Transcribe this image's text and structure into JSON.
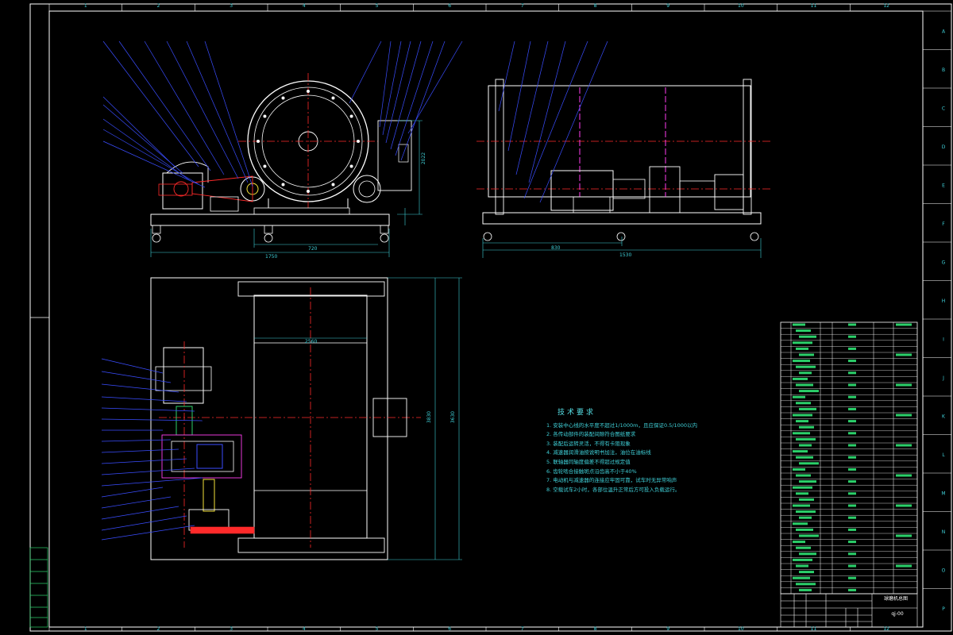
{
  "drawing": {
    "border_columns": [
      "1",
      "2",
      "3",
      "4",
      "5",
      "6",
      "7",
      "8",
      "9",
      "10",
      "11",
      "12"
    ],
    "border_rows": [
      "A",
      "B",
      "C",
      "D",
      "E",
      "F",
      "G",
      "H",
      "I",
      "J",
      "K",
      "L",
      "M",
      "N",
      "O",
      "P"
    ],
    "dimensions": {
      "side_height": "2022",
      "side_width": "1750",
      "side_inner": "720",
      "front_left": "830",
      "front_right": "1530",
      "plan_drum_width": "2560",
      "plan_height": "3830",
      "plan_height_outer": "3630"
    },
    "technical_requirements": {
      "title": "技术要求",
      "items": [
        "1. 安装中心线的水平度不超过1/1000m，且应保证0.5/1000以内",
        "2. 各传动部件的装配间隙符合图纸要求",
        "3. 装配后运转灵活，不得有卡阻现象",
        "4. 减速器润滑油按说明书加注，油位在油标线",
        "5. 联轴器同轴度偏差不得超过规定值",
        "6. 齿轮啮合接触斑点沿齿高不小于40%",
        "7. 电动机与减速器的连接应牢固可靠，试车时无异常响声",
        "8. 空载试车2小时，各部位温升正常后方可投入负载运行。"
      ]
    },
    "title_block": {
      "drawing_title": "球磨机总图",
      "drawing_code": "qj-00"
    },
    "colors": {
      "background": "#000000",
      "frame": "#ffffff",
      "cyan": "#3fd0d8",
      "blue": "#3a4dff",
      "red": "#ff2a2a",
      "magenta": "#ff3df0",
      "green": "#2bd06a",
      "yellow": "#f5e23a"
    }
  }
}
